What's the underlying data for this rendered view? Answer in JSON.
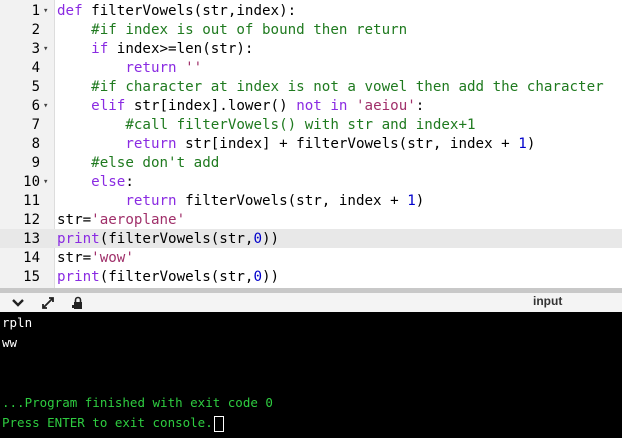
{
  "editor": {
    "lines": [
      {
        "num": "1",
        "fold": "▾",
        "tokens": [
          {
            "t": "def",
            "c": "kw"
          },
          {
            "t": " filterVowels(str,index):"
          }
        ]
      },
      {
        "num": "2",
        "fold": "",
        "tokens": [
          {
            "t": "    "
          },
          {
            "t": "#if index is out of bound then return",
            "c": "cm"
          }
        ]
      },
      {
        "num": "3",
        "fold": "▾",
        "tokens": [
          {
            "t": "    "
          },
          {
            "t": "if",
            "c": "kw"
          },
          {
            "t": " index>=len(str):"
          }
        ]
      },
      {
        "num": "4",
        "fold": "",
        "tokens": [
          {
            "t": "        "
          },
          {
            "t": "return",
            "c": "kw"
          },
          {
            "t": " "
          },
          {
            "t": "''",
            "c": "st"
          }
        ]
      },
      {
        "num": "5",
        "fold": "",
        "tokens": [
          {
            "t": "    "
          },
          {
            "t": "#if character at index is not a vowel then add the character",
            "c": "cm"
          }
        ]
      },
      {
        "num": "6",
        "fold": "▾",
        "tokens": [
          {
            "t": "    "
          },
          {
            "t": "elif",
            "c": "kw"
          },
          {
            "t": " str[index].lower() "
          },
          {
            "t": "not in",
            "c": "kw"
          },
          {
            "t": " "
          },
          {
            "t": "'aeiou'",
            "c": "st"
          },
          {
            "t": ":"
          }
        ]
      },
      {
        "num": "7",
        "fold": "",
        "tokens": [
          {
            "t": "        "
          },
          {
            "t": "#call filterVowels() with str and index+1",
            "c": "cm"
          }
        ]
      },
      {
        "num": "8",
        "fold": "",
        "tokens": [
          {
            "t": "        "
          },
          {
            "t": "return",
            "c": "kw"
          },
          {
            "t": " str[index] + filterVowels(str, index + "
          },
          {
            "t": "1",
            "c": "nm"
          },
          {
            "t": ")"
          }
        ]
      },
      {
        "num": "9",
        "fold": "",
        "tokens": [
          {
            "t": "    "
          },
          {
            "t": "#else don't add",
            "c": "cm"
          }
        ]
      },
      {
        "num": "10",
        "fold": "▾",
        "tokens": [
          {
            "t": "    "
          },
          {
            "t": "else",
            "c": "kw"
          },
          {
            "t": ":"
          }
        ]
      },
      {
        "num": "11",
        "fold": "",
        "tokens": [
          {
            "t": "        "
          },
          {
            "t": "return",
            "c": "kw"
          },
          {
            "t": " filterVowels(str, index + "
          },
          {
            "t": "1",
            "c": "nm"
          },
          {
            "t": ")"
          }
        ]
      },
      {
        "num": "12",
        "fold": "",
        "tokens": [
          {
            "t": "str="
          },
          {
            "t": "'aeroplane'",
            "c": "st"
          }
        ]
      },
      {
        "num": "13",
        "fold": "",
        "active": true,
        "tokens": [
          {
            "t": "print",
            "c": "kw"
          },
          {
            "t": "(filterVowels(str,"
          },
          {
            "t": "0",
            "c": "nm"
          },
          {
            "t": "))"
          }
        ]
      },
      {
        "num": "14",
        "fold": "",
        "tokens": [
          {
            "t": "str="
          },
          {
            "t": "'wow'",
            "c": "st"
          }
        ]
      },
      {
        "num": "15",
        "fold": "",
        "tokens": [
          {
            "t": "print",
            "c": "kw"
          },
          {
            "t": "(filterVowels(str,"
          },
          {
            "t": "0",
            "c": "nm"
          },
          {
            "t": "))"
          }
        ]
      }
    ]
  },
  "toolbar": {
    "input_label": "input",
    "icons": [
      "chevron-down-icon",
      "expand-icon",
      "lock-settings-icon"
    ]
  },
  "console": {
    "lines": [
      {
        "text": "rpln",
        "style": "white"
      },
      {
        "text": "ww",
        "style": "white"
      },
      {
        "text": "",
        "style": "white"
      },
      {
        "text": "",
        "style": "white"
      },
      {
        "text": "...Program finished with exit code 0",
        "style": "green"
      },
      {
        "text": "Press ENTER to exit console.",
        "style": "green",
        "cursor": true
      }
    ]
  },
  "colors": {
    "keyword": "#8a2be2",
    "comment": "#1f7a1f",
    "string": "#a0306a",
    "number": "#0000cc",
    "console_green": "#2ecc40"
  }
}
